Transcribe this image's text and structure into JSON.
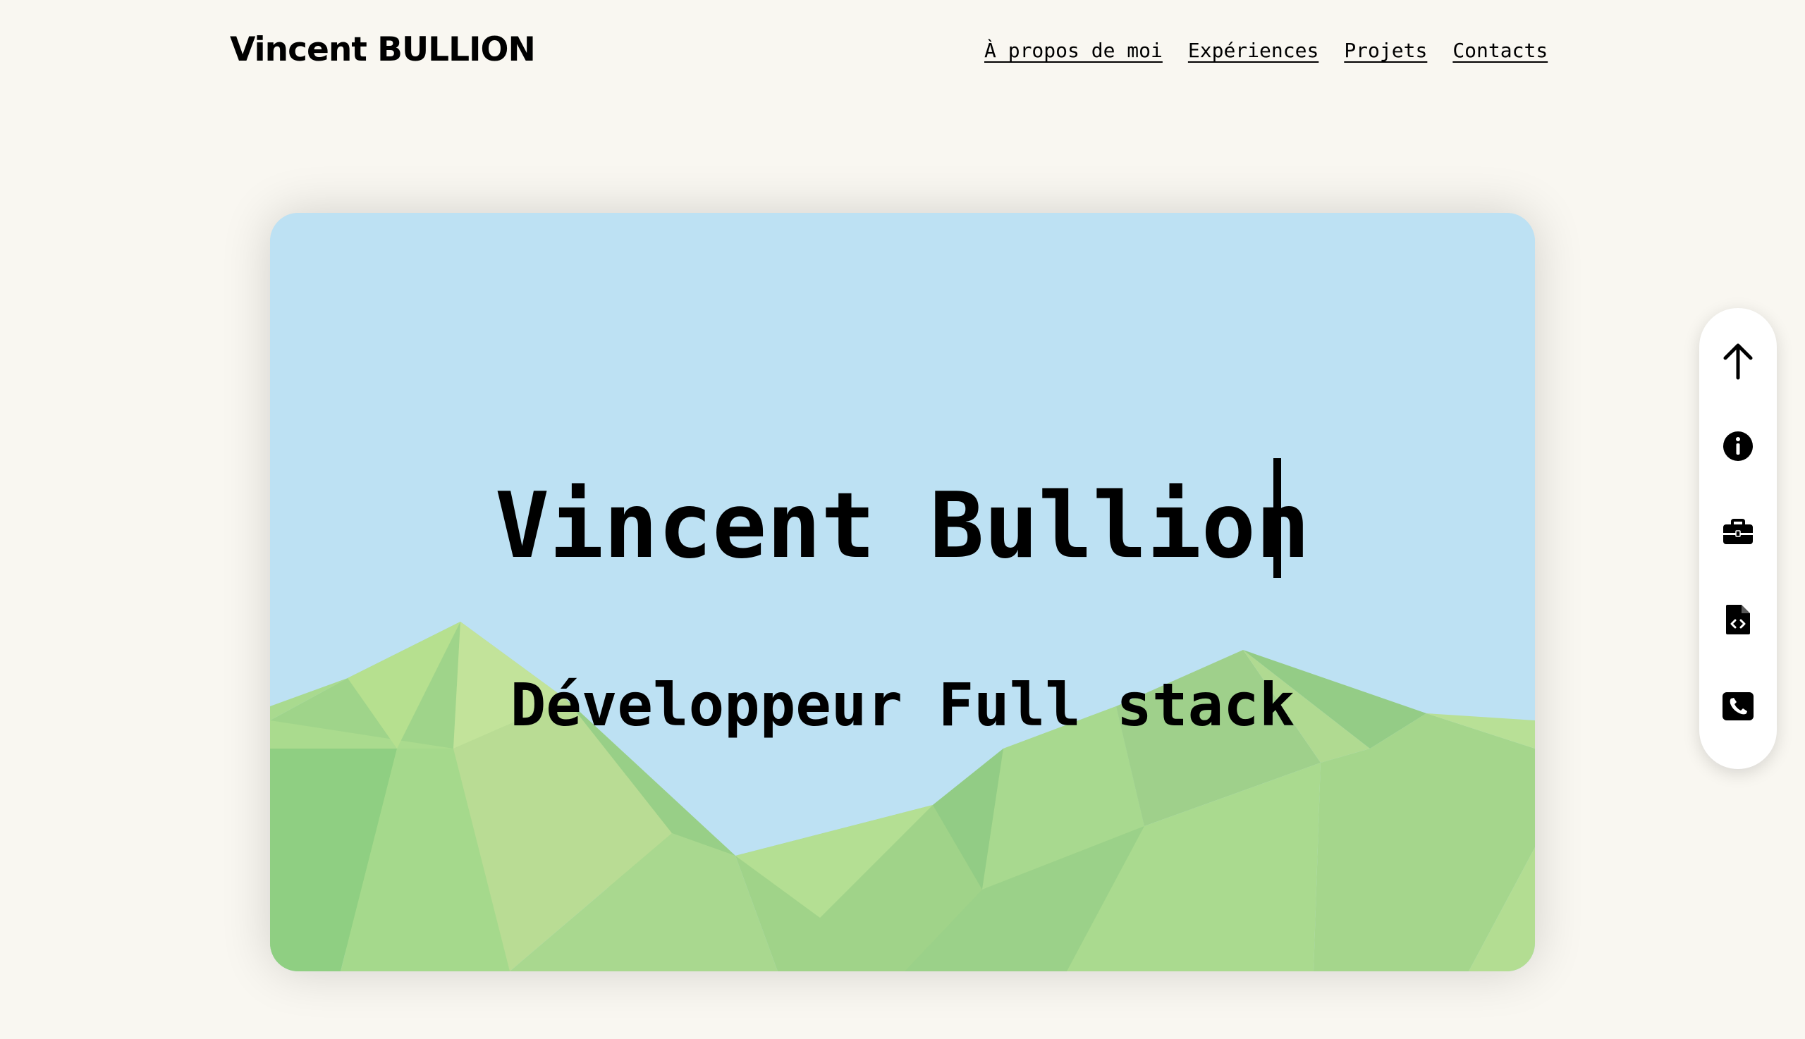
{
  "header": {
    "brand": "Vincent BULLION",
    "nav": [
      {
        "label": "À propos de moi"
      },
      {
        "label": "Expériences"
      },
      {
        "label": "Projets"
      },
      {
        "label": "Contacts"
      }
    ]
  },
  "hero": {
    "name": "Vincent Bullion",
    "role": "Développeur Full stack"
  },
  "side_nav": {
    "items": [
      {
        "icon": "arrow-up-icon"
      },
      {
        "icon": "info-icon"
      },
      {
        "icon": "briefcase-icon"
      },
      {
        "icon": "code-file-icon"
      },
      {
        "icon": "phone-icon"
      }
    ]
  },
  "colors": {
    "page_background": "#f9f7f1",
    "sky": "#bde1f3",
    "hills": "#a7d88a",
    "text": "#000000"
  }
}
